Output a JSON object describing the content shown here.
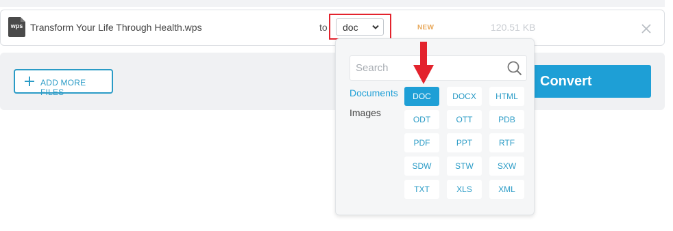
{
  "file": {
    "name": "Transform Your Life Through Health.wps",
    "icon_label": "wps",
    "to_label": "to",
    "format_value": "doc",
    "badge": "NEW",
    "size": "120.51 KB"
  },
  "actions": {
    "add_more_label": "ADD MORE FILES",
    "convert_label": "Convert"
  },
  "dropdown": {
    "search_placeholder": "Search",
    "categories": [
      {
        "label": "Documents",
        "active": true
      },
      {
        "label": "Images",
        "active": false
      }
    ],
    "formats": [
      "DOC",
      "DOCX",
      "HTML",
      "ODT",
      "OTT",
      "PDB",
      "PDF",
      "PPT",
      "RTF",
      "SDW",
      "STW",
      "SXW",
      "TXT",
      "XLS",
      "XML"
    ],
    "selected_format": "DOC"
  },
  "colors": {
    "accent": "#1e9fd6",
    "highlight_red": "#e3232d",
    "badge": "#e8a85a"
  }
}
